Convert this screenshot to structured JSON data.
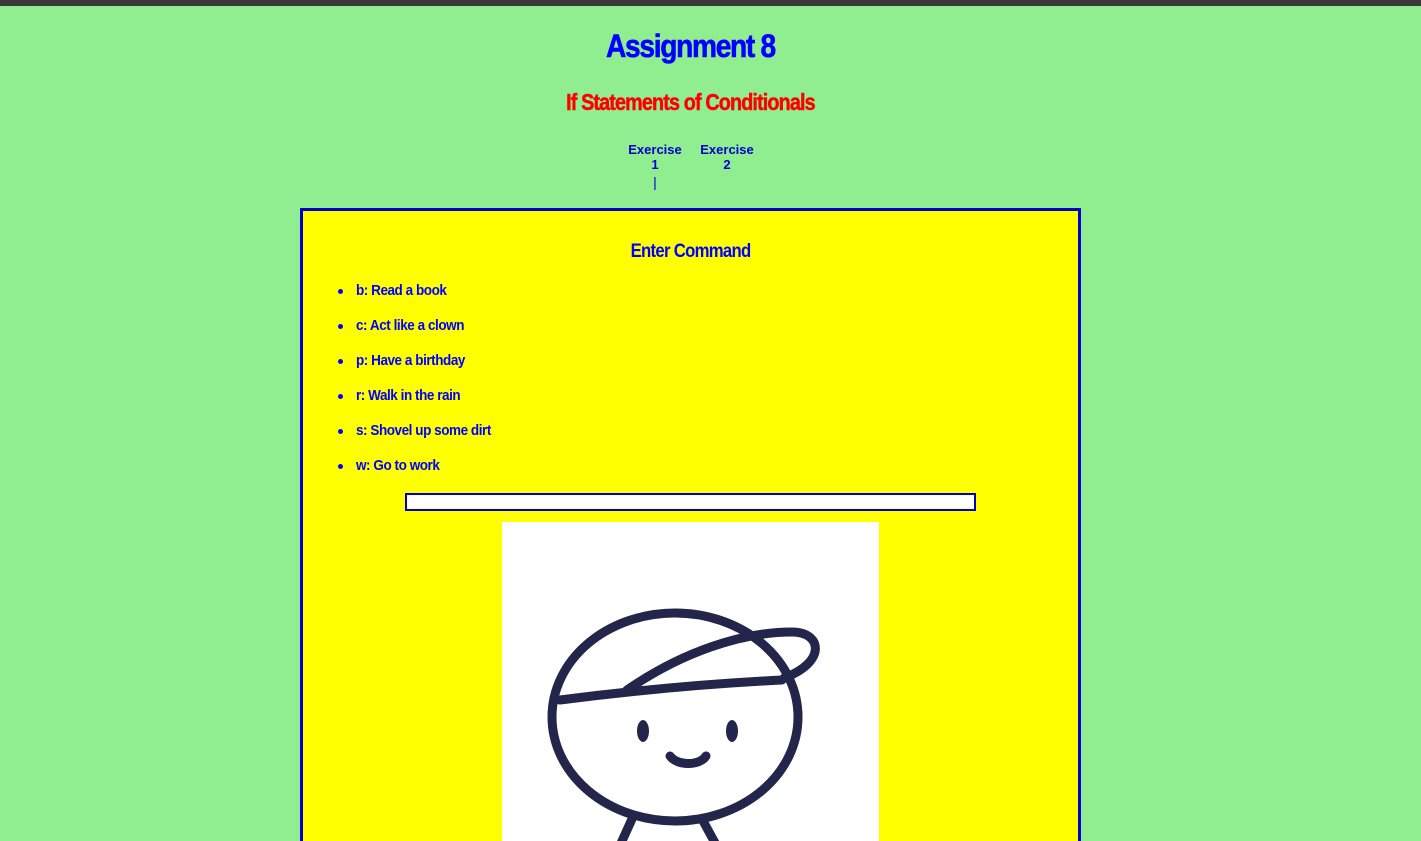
{
  "page": {
    "title": "Assignment 8",
    "subtitle": "If Statements of Conditionals"
  },
  "nav": {
    "links": [
      {
        "line1": "Exercise",
        "line2": "1"
      },
      {
        "line1": "Exercise",
        "line2": "2"
      }
    ],
    "separator": "|"
  },
  "panel": {
    "heading": "Enter Command",
    "commands": [
      "b: Read a book",
      "c: Act like a clown",
      "p: Have a birthday",
      "r: Walk in the rain",
      "s: Shovel up some dirt",
      "w: Go to work"
    ],
    "input_value": "",
    "image_icon": "cartoon-boy-with-cap"
  },
  "colors": {
    "background": "#90ee90",
    "panel": "#ffff00",
    "border": "#0000cd",
    "title": "#0000ff",
    "subtitle": "#ff0000",
    "drawing_stroke": "#23264a"
  }
}
